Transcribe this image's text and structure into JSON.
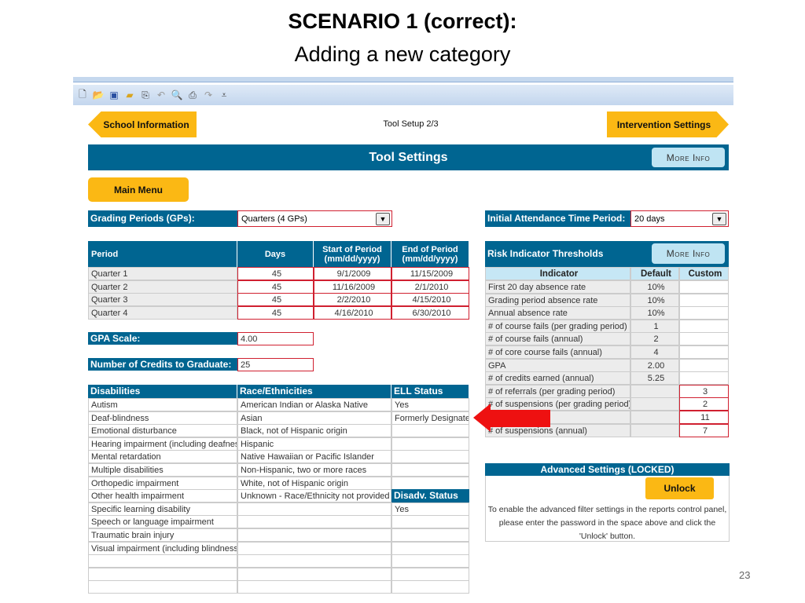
{
  "slide": {
    "title": "SCENARIO 1 (correct):",
    "subtitle": "Adding a new category",
    "page_number": "23"
  },
  "toolbar": {
    "icons": [
      "new-icon",
      "open-icon",
      "save-icon",
      "folder-icon",
      "attach-icon",
      "undo-icon",
      "print-preview-icon",
      "print-icon",
      "redo-icon",
      "customize-icon"
    ]
  },
  "nav": {
    "back": "School Information",
    "step": "Tool Setup 2/3",
    "next": "Intervention Settings"
  },
  "header": {
    "title": "Tool Settings",
    "more_info": "More Info",
    "main_menu": "Main Menu"
  },
  "grading": {
    "label": "Grading Periods (GPs):",
    "value": "Quarters (4 GPs)"
  },
  "periods": {
    "headers": [
      "Period",
      "Days",
      "Start of Period (mm/dd/yyyy)",
      "End of Period (mm/dd/yyyy)"
    ],
    "rows": [
      [
        "Quarter 1",
        "45",
        "9/1/2009",
        "11/15/2009"
      ],
      [
        "Quarter 2",
        "45",
        "11/16/2009",
        "2/1/2010"
      ],
      [
        "Quarter 3",
        "45",
        "2/2/2010",
        "4/15/2010"
      ],
      [
        "Quarter 4",
        "45",
        "4/16/2010",
        "6/30/2010"
      ]
    ]
  },
  "gpa": {
    "label": "GPA Scale:",
    "value": "4.00"
  },
  "credits": {
    "label": "Number of Credits to Graduate:",
    "value": "25"
  },
  "categories": {
    "headers": [
      "Disabilities",
      "Race/Ethnicities",
      "ELL Status"
    ],
    "disabilities": [
      "Autism",
      "Deaf-blindness",
      "Emotional disturbance",
      "Hearing impairment (including deafness)",
      "Mental retardation",
      "Multiple disabilities",
      "Orthopedic impairment",
      "Other health impairment",
      "Specific learning disability",
      "Speech or language impairment",
      "Traumatic brain injury",
      "Visual impairment (including blindness)",
      "",
      "",
      ""
    ],
    "races": [
      "American Indian or Alaska Native",
      "Asian",
      "Black, not of Hispanic origin",
      "Hispanic",
      "Native Hawaiian  or Pacific Islander",
      "Non-Hispanic, two or more races",
      "White, not of Hispanic origin",
      "Unknown - Race/Ethnicity not provided",
      "",
      "",
      "",
      "",
      "",
      "",
      ""
    ],
    "ell": [
      "Yes",
      "Formerly Designated",
      "",
      "",
      "",
      "",
      ""
    ],
    "disadv_header": "Disadv. Status",
    "disadv": [
      "Yes",
      "",
      "",
      "",
      "",
      "",
      ""
    ]
  },
  "attendance": {
    "label": "Initial Attendance Time Period:",
    "value": "20 days"
  },
  "risk": {
    "title": "Risk Indicator Thresholds",
    "more_info": "More Info",
    "headers": [
      "Indicator",
      "Default",
      "Custom"
    ],
    "rows": [
      [
        "First 20 day absence rate",
        "10%",
        ""
      ],
      [
        "Grading period absence rate",
        "10%",
        ""
      ],
      [
        "Annual absence rate",
        "10%",
        ""
      ],
      [
        "# of course fails (per grading period)",
        "1",
        ""
      ],
      [
        "# of course fails (annual)",
        "2",
        ""
      ],
      [
        "# of core course fails (annual)",
        "4",
        ""
      ],
      [
        "GPA",
        "2.00",
        ""
      ],
      [
        "# of credits earned (annual)",
        "5.25",
        ""
      ],
      [
        "# of referrals (per grading period)",
        "",
        "3"
      ],
      [
        "# of suspensions (per grading period)",
        "",
        "2"
      ],
      [
        "",
        "",
        "11"
      ],
      [
        "# of suspensions (annual)",
        "",
        "7"
      ]
    ]
  },
  "advanced": {
    "title": "Advanced Settings (LOCKED)",
    "unlock": "Unlock",
    "text": [
      "To enable the advanced filter settings in the reports control panel,",
      "please enter the password in the space above and click the",
      "'Unlock' button."
    ]
  },
  "colors": {
    "header_blue": "#006591",
    "accent_yellow": "#fbb814",
    "input_border": "#d02030",
    "arrow": "#ee1111"
  }
}
